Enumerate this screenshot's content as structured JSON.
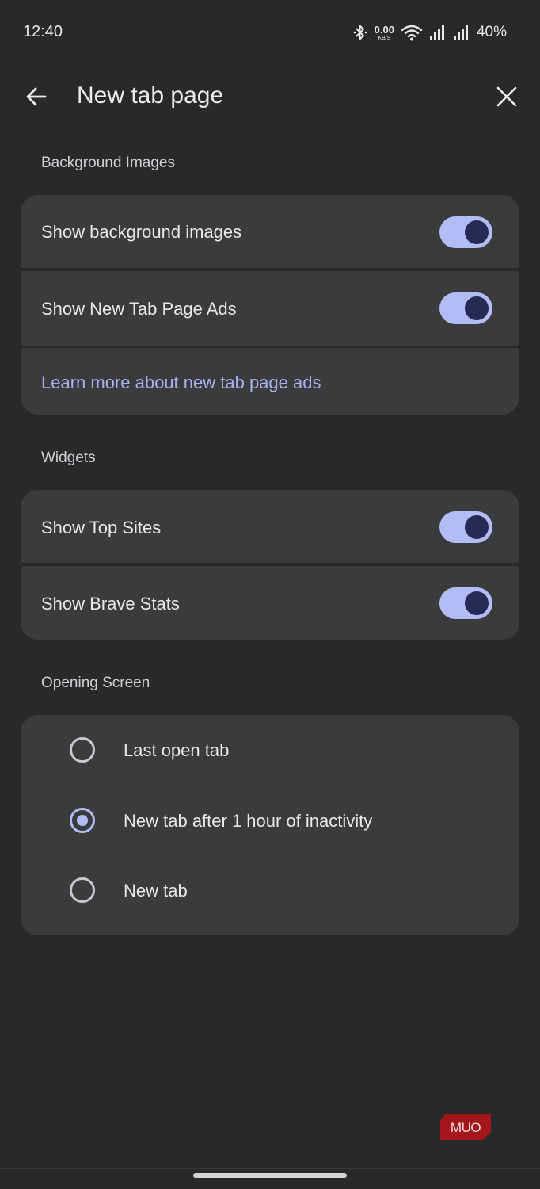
{
  "status_bar": {
    "time": "12:40",
    "net_speed_value": "0.00",
    "net_speed_unit": "KB/S",
    "battery": "40%",
    "icons": [
      "bluetooth-icon",
      "wifi-icon",
      "signal-icon",
      "signal-icon"
    ]
  },
  "header": {
    "title": "New tab page",
    "back_icon": "arrow-left-icon",
    "close_icon": "close-icon"
  },
  "sections": {
    "background": {
      "label": "Background Images",
      "items": [
        {
          "label": "Show background images",
          "enabled": true
        },
        {
          "label": "Show New Tab Page Ads",
          "enabled": true
        }
      ],
      "link": "Learn more about new tab page ads"
    },
    "widgets": {
      "label": "Widgets",
      "items": [
        {
          "label": "Show Top Sites",
          "enabled": true
        },
        {
          "label": "Show Brave Stats",
          "enabled": true
        }
      ]
    },
    "opening": {
      "label": "Opening Screen",
      "options": [
        {
          "label": "Last open tab",
          "selected": false
        },
        {
          "label": "New tab after 1 hour of inactivity",
          "selected": true
        },
        {
          "label": "New tab",
          "selected": false
        }
      ]
    }
  },
  "watermark": "MUO",
  "colors": {
    "background": "#28292a",
    "card": "#3a3b3d",
    "accent": "#b3bdf5",
    "toggle_knob": "#262b55",
    "link": "#a8b1f0"
  }
}
